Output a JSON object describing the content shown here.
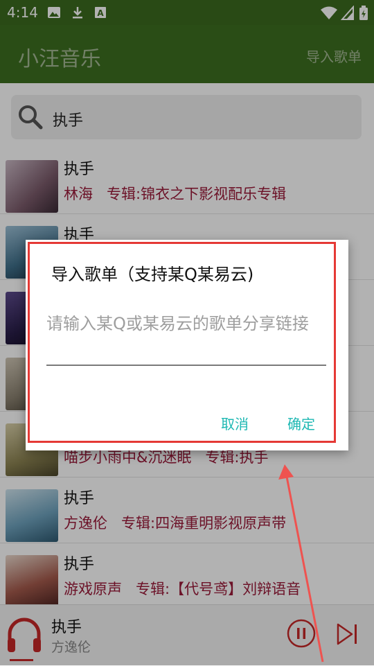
{
  "status_bar": {
    "time": "4:14"
  },
  "app_bar": {
    "title": "小汪音乐",
    "import_label": "导入歌单"
  },
  "search": {
    "query": "执手"
  },
  "songs": [
    {
      "title": "执手",
      "artist": "林海",
      "album": "专辑:锦衣之下影视配乐专辑"
    },
    {
      "title": "执手",
      "artist": "",
      "album": ""
    },
    {
      "title": "",
      "artist": "",
      "album": ""
    },
    {
      "title": "",
      "artist": "",
      "album": ""
    },
    {
      "title": "",
      "artist": "喵步小雨中&沉迷眠",
      "album": "专辑:执手"
    },
    {
      "title": "执手",
      "artist": "方逸伦",
      "album": "专辑:四海重明影视原声带"
    },
    {
      "title": "执手",
      "artist": "游戏原声",
      "album": "专辑:【代号鸢】刘辩语音"
    }
  ],
  "now_playing": {
    "title": "执手",
    "artist": "方逸伦"
  },
  "dialog": {
    "title": "导入歌单（支持某Q某易云)",
    "placeholder": "请输入某Q或某易云的歌单分享链接",
    "cancel": "取消",
    "confirm": "确定"
  },
  "colors": {
    "app_bar": "#3d6f20",
    "accent": "#1eb8b3",
    "highlight_border": "#e53935",
    "artist_text": "#9b1b3a"
  }
}
